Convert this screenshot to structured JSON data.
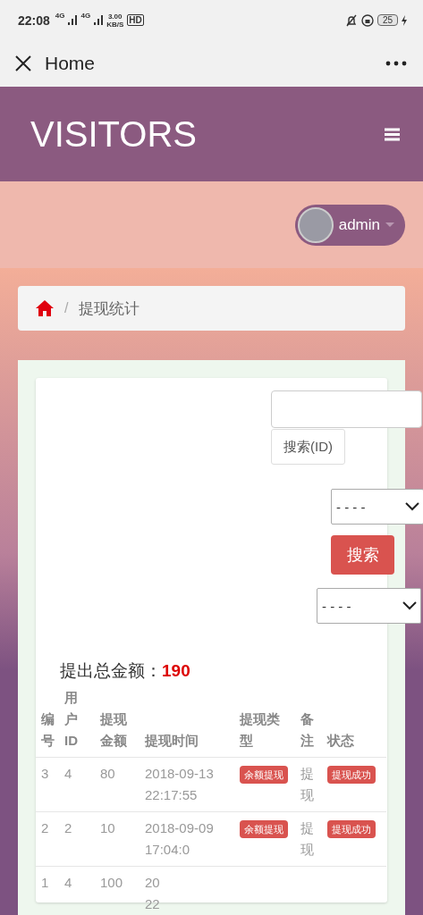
{
  "status_bar": {
    "time": "22:08",
    "net_labels": [
      "4G",
      "4G"
    ],
    "speed": [
      "3.00",
      "KB/S"
    ],
    "hd": "HD",
    "battery": "25"
  },
  "app_bar": {
    "title": "Home"
  },
  "header": {
    "brand": "VISITORS"
  },
  "user": {
    "name": "admin"
  },
  "breadcrumb": {
    "separator": "/",
    "current": "提现统计"
  },
  "filters": {
    "id_search_button": "搜索(ID)",
    "select_1": "- - - -",
    "search_button": "搜索",
    "select_2": "- - - -"
  },
  "total": {
    "label": "提出总金额：",
    "value": "190"
  },
  "table": {
    "columns": [
      "编号",
      "用户ID",
      "提现金额",
      "提现时间",
      "提现类型",
      "备注",
      "状态"
    ],
    "rows": [
      {
        "id": "3",
        "user_id": "4",
        "amount": "80",
        "time": [
          "2018-09-13",
          "22:17:55"
        ],
        "type": "余额提现",
        "remark": "提现",
        "status": "提现成功"
      },
      {
        "id": "2",
        "user_id": "2",
        "amount": "10",
        "time": [
          "2018-09-09",
          "17:04:0"
        ],
        "type": "余额提现",
        "remark": "提现",
        "status": "提现成功"
      },
      {
        "id": "1",
        "user_id": "4",
        "amount": "100",
        "time": [
          "20",
          "22"
        ]
      }
    ]
  }
}
